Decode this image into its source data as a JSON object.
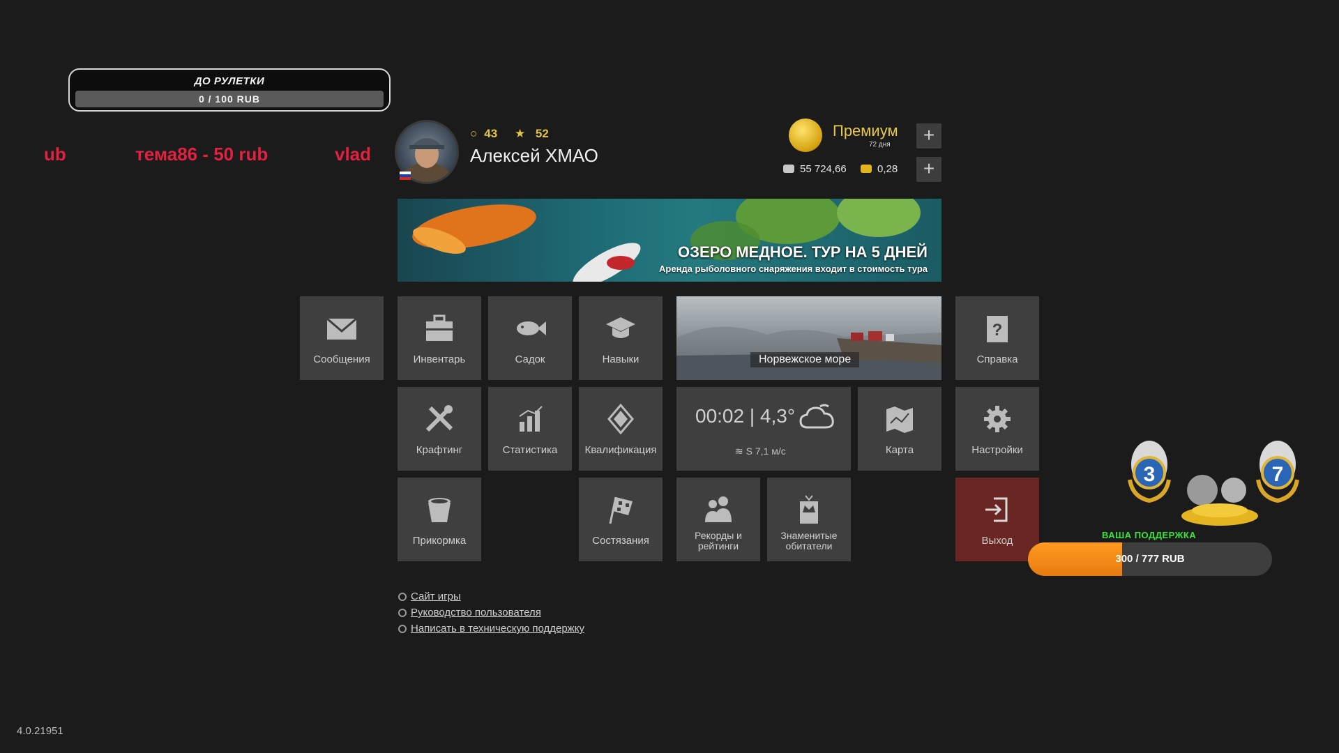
{
  "roulette": {
    "title": "ДО РУЛЕТКИ",
    "progress_text": "0 / 100 RUB",
    "current": 0,
    "target": 100,
    "fill_color": "#e58b14"
  },
  "donors": [
    "ub",
    "тема86 - 50 rub",
    "vlad"
  ],
  "profile": {
    "level": "43",
    "stars": "52",
    "name": "Алексей ХМАО",
    "flag": "russia-flag-icon"
  },
  "premium": {
    "label": "Премиум",
    "days": "72 дня"
  },
  "currency": {
    "silver": "55 724,66",
    "gold": "0,28"
  },
  "banner": {
    "title": "ОЗЕРО МЕДНОЕ. ТУР НА 5 ДНЕЙ",
    "subtitle": "Аренда рыболовного снаряжения входит в стоимость тура"
  },
  "tiles": {
    "messages": "Сообщения",
    "inventory": "Инвентарь",
    "keepnet": "Садок",
    "skills": "Навыки",
    "help": "Справка",
    "crafting": "Крафтинг",
    "statistics": "Статистика",
    "qualification": "Квалификация",
    "map": "Карта",
    "settings": "Настройки",
    "groundbait": "Прикормка",
    "competitions": "Состязания",
    "records_line1": "Рекорды и",
    "records_line2": "рейтинги",
    "famous_line1": "Знаменитые",
    "famous_line2": "обитатели",
    "exit": "Выход"
  },
  "location": {
    "name": "Норвежское море"
  },
  "weather": {
    "time": "00:02",
    "temperature": "4,3°",
    "wind": "S 7,1 м/с",
    "icon": "cloud-icon"
  },
  "links": [
    "Сайт игры",
    "Руководство пользователя",
    "Написать в техническую поддержку"
  ],
  "version": "4.0.21951",
  "support": {
    "title": "ВАША ПОДДЕРЖКА",
    "progress_text": "300 / 777 RUB",
    "current": 300,
    "target": 777,
    "medal_left": "3",
    "medal_right": "7"
  },
  "colors": {
    "background": "#1b1b1b",
    "tile": "#3f3f3f",
    "exit_tile": "#6a2622",
    "donor_text": "#e0213f",
    "gold_text": "#e2c542",
    "support_title": "#3ce33c"
  }
}
